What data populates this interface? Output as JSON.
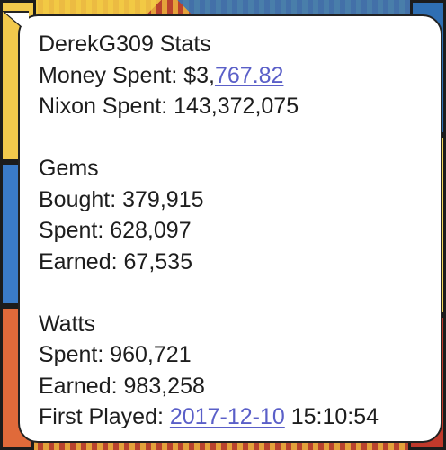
{
  "stats": {
    "title": "DerekG309 Stats",
    "money_spent_label": "Money Spent: ",
    "money_spent_prefix": "$3,",
    "money_spent_link": "767.82",
    "nixon_spent": "Nixon Spent: 143,372,075",
    "gems": {
      "heading": "Gems",
      "bought": "Bought: 379,915",
      "spent": "Spent: 628,097",
      "earned": "Earned: 67,535"
    },
    "watts": {
      "heading": "Watts",
      "spent": "Spent: 960,721",
      "earned": "Earned: 983,258"
    },
    "first_played_label": "First Played: ",
    "first_played_date": "2017-12-10",
    "first_played_time": " 15:10:54"
  },
  "colors": {
    "link": "#5a5fc8",
    "text": "#1d1d1d",
    "bubble": "#ffffff"
  }
}
